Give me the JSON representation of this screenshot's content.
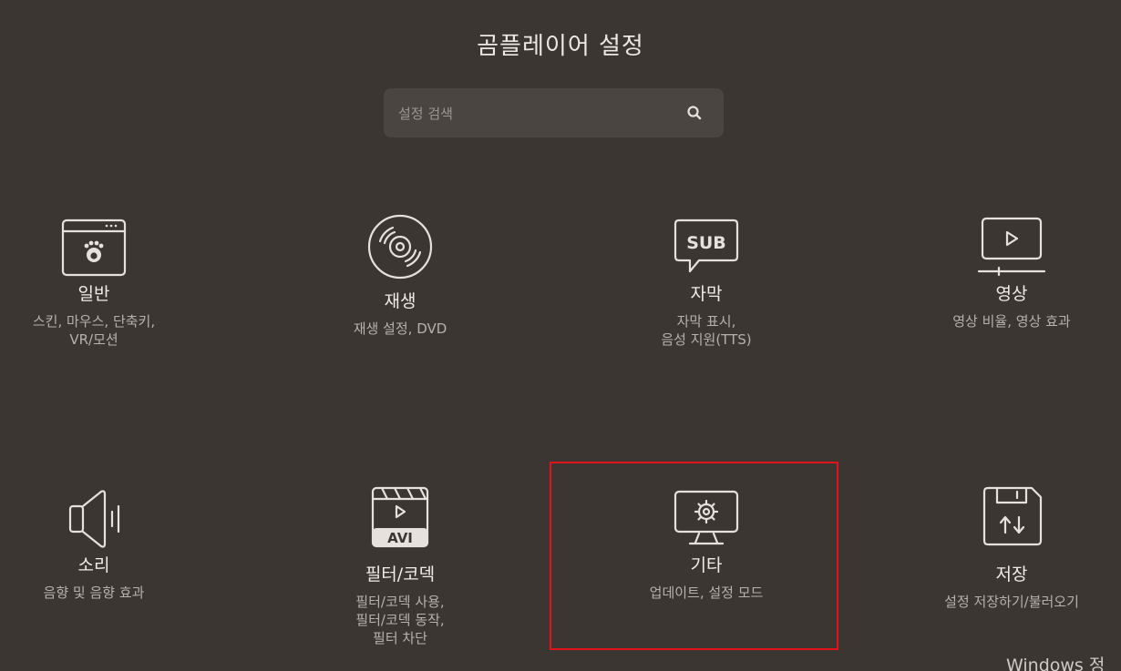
{
  "header": {
    "title": "곰플레이어 설정"
  },
  "search": {
    "placeholder": "설정 검색",
    "icon": "search-icon"
  },
  "categories": [
    {
      "name": "일반",
      "desc_lines": [
        "스킨, 마우스, 단축키,",
        "VR/모션"
      ],
      "icon": "general-window-icon"
    },
    {
      "name": "재생",
      "desc_lines": [
        "재생 설정, DVD"
      ],
      "icon": "disc-icon"
    },
    {
      "name": "자막",
      "desc_lines": [
        "자막 표시,",
        "음성 지원(TTS)"
      ],
      "icon": "subtitle-icon"
    },
    {
      "name": "영상",
      "desc_lines": [
        "영상 비율, 영상 효과"
      ],
      "icon": "video-player-icon"
    },
    {
      "name": "소리",
      "desc_lines": [
        "음향 및 음향 효과"
      ],
      "icon": "speaker-icon"
    },
    {
      "name": "필터/코덱",
      "desc_lines": [
        "필터/코덱 사용,",
        "필터/코덱 동작,",
        "필터 차단"
      ],
      "icon": "clapper-avi-icon"
    },
    {
      "name": "기타",
      "desc_lines": [
        "업데이트, 설정 모드"
      ],
      "icon": "monitor-gear-icon"
    },
    {
      "name": "저장",
      "desc_lines": [
        "설정 저장하기/불러오기"
      ],
      "icon": "save-disk-icon"
    }
  ],
  "selected_category": "기타",
  "highlight_color": "#e0141a",
  "watermark": {
    "text": "Windows 정"
  }
}
